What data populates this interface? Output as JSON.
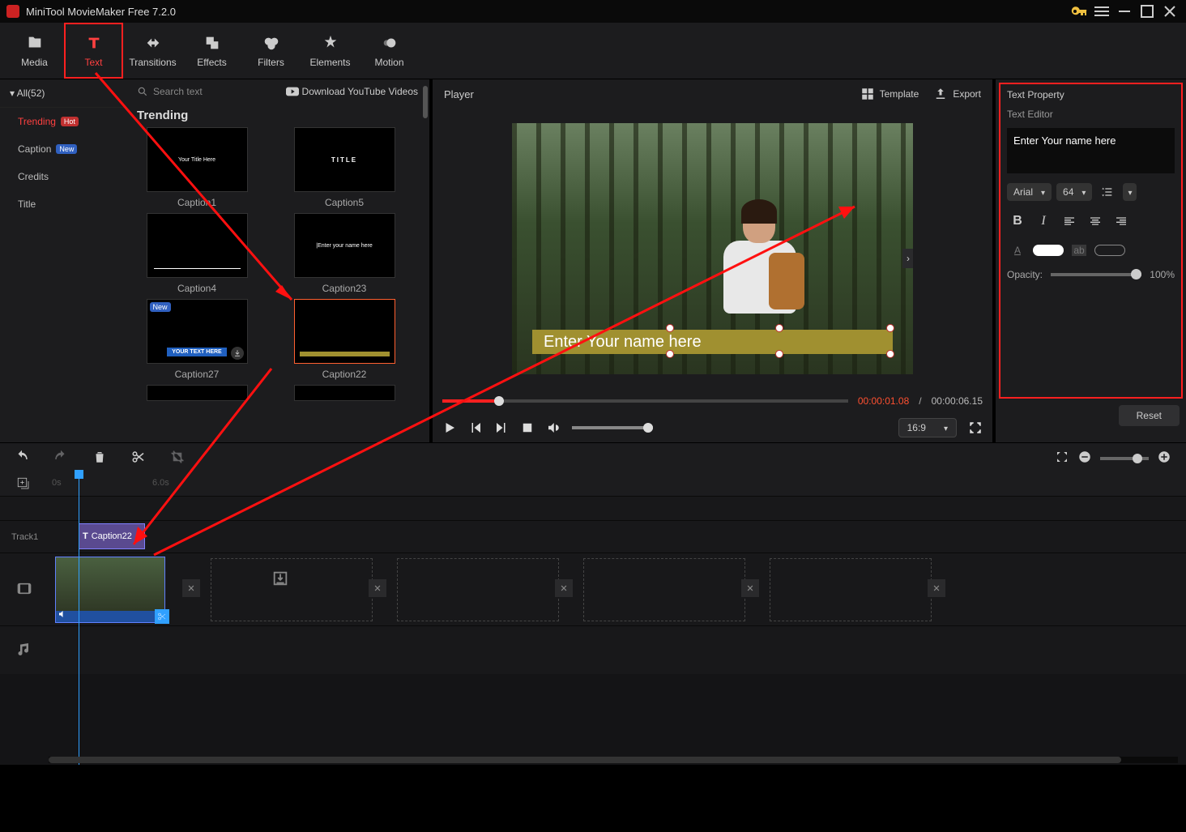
{
  "titlebar": {
    "title": "MiniTool MovieMaker Free 7.2.0"
  },
  "toolbar": {
    "media": "Media",
    "text": "Text",
    "transitions": "Transitions",
    "effects": "Effects",
    "filters": "Filters",
    "elements": "Elements",
    "motion": "Motion"
  },
  "sidebar": {
    "all": "All(52)",
    "items": [
      {
        "label": "Trending",
        "badge": "Hot",
        "active": true
      },
      {
        "label": "Caption",
        "badge": "New"
      },
      {
        "label": "Credits"
      },
      {
        "label": "Title"
      }
    ]
  },
  "gallery": {
    "search_placeholder": "Search text",
    "download_yt": "Download YouTube Videos",
    "section": "Trending",
    "items": [
      {
        "label": "Caption1",
        "hint": "Your Title Here"
      },
      {
        "label": "Caption5",
        "hint": "TITLE"
      },
      {
        "label": "Caption4",
        "hint": ""
      },
      {
        "label": "Caption23",
        "hint": "Enter your name here"
      },
      {
        "label": "Caption27",
        "hint": "YOUR TEXT HERE",
        "badge": "New"
      },
      {
        "label": "Caption22",
        "hint": "",
        "selected": true
      }
    ]
  },
  "player": {
    "label": "Player",
    "template": "Template",
    "export": "Export",
    "caption_text": "Enter Your name here",
    "time_current": "00:00:01.08",
    "time_total": "00:00:06.15",
    "aspect": "16:9"
  },
  "property": {
    "title": "Text Property",
    "editor_label": "Text Editor",
    "text_value": "Enter Your name here",
    "font": "Arial",
    "size": "64",
    "opacity_label": "Opacity:",
    "opacity_value": "100%",
    "reset": "Reset"
  },
  "timeline": {
    "ruler": {
      "t0": "0s",
      "t6": "6.0s"
    },
    "track1_label": "Track1",
    "text_clip": "Caption22"
  }
}
